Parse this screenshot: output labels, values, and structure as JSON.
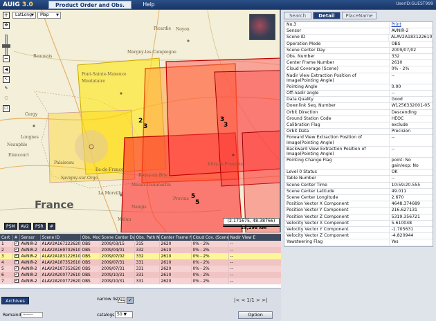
{
  "app": {
    "logo": "AUIG",
    "version": "3.0",
    "order_button": "Product Order and Obs. Request",
    "help": "Help",
    "user_id": "UserID:GUEST999"
  },
  "map": {
    "coord_select": "LatLong",
    "map_select": "Map",
    "country_label": "France",
    "towns": [
      "Picardie",
      "Noyon",
      "Margny-les-Compiegne",
      "Beauvais",
      "Pont-Sainte-Maxence",
      "Montataire",
      "Cergy",
      "Elancourt",
      "Palaiseau",
      "Savigny-sur-Orge",
      "Ile-de-France",
      "La Morville",
      "Meaux-Dammartin",
      "Nangis",
      "Provins",
      "Vitry-le-Francois",
      "Rozay-en-Brie",
      "Melun",
      "Longnes",
      "Neauphle"
    ],
    "coord_readout": "(2.171675, 48.38766)",
    "scale_label": "25,298 km",
    "toggles": [
      "PSM",
      "AV2",
      "PSR",
      "#"
    ],
    "markers": [
      "2",
      "3",
      "3",
      "3",
      "5",
      "5"
    ]
  },
  "panel": {
    "tabs": [
      "Search",
      "Detail",
      "PlaceName"
    ],
    "active_tab": "Detail",
    "rows": [
      {
        "label": "No.3",
        "value": "Print"
      },
      {
        "label": "Sensor",
        "value": "AVNIR-2"
      },
      {
        "label": "Scene ID",
        "value": "ALAV2A183122610"
      },
      {
        "label": "Operation Mode",
        "value": "OBS"
      },
      {
        "label": "Scene Center Day",
        "value": "2009/07/02"
      },
      {
        "label": "Obs. Number",
        "value": "332"
      },
      {
        "label": "Center Frame Number",
        "value": "2610"
      },
      {
        "label": "Cloud Coverage (Scene)",
        "value": "0% - 2%"
      },
      {
        "label": "Nadir View Extraction Position of Image(Pointing Angle)",
        "value": "--"
      },
      {
        "label": "Pointing Angle",
        "value": "0.00"
      },
      {
        "label": "Off-nadir angle",
        "value": "--"
      },
      {
        "label": "Data Quality",
        "value": "Good"
      },
      {
        "label": "Downlink Seq. Number",
        "value": "W1256332001-05"
      },
      {
        "label": "Orbit Direction",
        "value": "Descending"
      },
      {
        "label": "Ground Station Code",
        "value": "HEOC"
      },
      {
        "label": "Calibration Flag",
        "value": "exclude"
      },
      {
        "label": "Orbit Data",
        "value": "Precision"
      },
      {
        "label": "Forward View Extraction Position of Image(Pointing Angle)",
        "value": "--"
      },
      {
        "label": "Backward View Extraction Position of Image(Pointing Angle)",
        "value": "--"
      },
      {
        "label": "Pointing Change Flag",
        "value": "point: No gain/exp: No"
      },
      {
        "label": "Level 0 Status",
        "value": "OK"
      },
      {
        "label": "Table Number",
        "value": "--"
      },
      {
        "label": "Scene Center Time",
        "value": "10:59:20.555"
      },
      {
        "label": "Scene Center Latitude",
        "value": "49.011"
      },
      {
        "label": "Scene Center Longitude",
        "value": "2.670"
      },
      {
        "label": "Position Vector X Component",
        "value": "4648.374689"
      },
      {
        "label": "Position Vector Y Component",
        "value": "216.627131"
      },
      {
        "label": "Position Vector Z Component",
        "value": "5319.356721"
      },
      {
        "label": "Velocity Vector X Component",
        "value": "5.610048"
      },
      {
        "label": "Velocity Vector Y Component",
        "value": "-1.705631"
      },
      {
        "label": "Velocity Vector Z Component",
        "value": "-4.820944"
      },
      {
        "label": "Yawsteering Flag",
        "value": "Yes"
      }
    ]
  },
  "table": {
    "headers": [
      "Cart",
      "#",
      "Sensor",
      "Scene ID",
      "Obs. Mode",
      "Scene Center Day",
      "Obs. Path No.",
      "Center Frame No.",
      "Cloud Cov. (Scene)",
      "Nadir View E"
    ],
    "rows": [
      [
        "1",
        "AVNIR-2",
        "ALAV2A167222620",
        "OBS",
        "2009/03/15",
        "315",
        "2620",
        "0% - 2%",
        "--"
      ],
      [
        "2",
        "AVNIR-2",
        "ALAV2A169702610",
        "OBS",
        "2009/04/01",
        "332",
        "2610",
        "0% - 2%",
        "--"
      ],
      [
        "3",
        "AVNIR-2",
        "ALAV2A183122610",
        "OBS",
        "2009/07/02",
        "332",
        "2610",
        "0% - 2%",
        "--"
      ],
      [
        "4",
        "AVNIR-2",
        "ALAV2A187352610",
        "OBS",
        "2009/07/31",
        "331",
        "2610",
        "0% - 2%",
        "--"
      ],
      [
        "5",
        "AVNIR-2",
        "ALAV2A187352620",
        "OBS",
        "2009/07/31",
        "331",
        "2620",
        "0% - 2%",
        "--"
      ],
      [
        "6",
        "AVNIR-2",
        "ALAV2A200772610",
        "OBS",
        "2009/10/31",
        "331",
        "2610",
        "0% - 2%",
        "--"
      ],
      [
        "7",
        "AVNIR-2",
        "ALAV2A200772620",
        "OBS",
        "2009/10/31",
        "331",
        "2620",
        "0% - 2%",
        "--"
      ]
    ],
    "selected_row": 3
  },
  "bottom": {
    "archives": "Archives",
    "narrow_list": "narrow list",
    "narrow_all": "ALL",
    "pager": "|< < 1/1 > >|",
    "remainder_label": "Remainder :",
    "remainder_value": "--------",
    "catalogs_label": "catalogs :",
    "catalogs_value": "50",
    "option": "Option"
  }
}
